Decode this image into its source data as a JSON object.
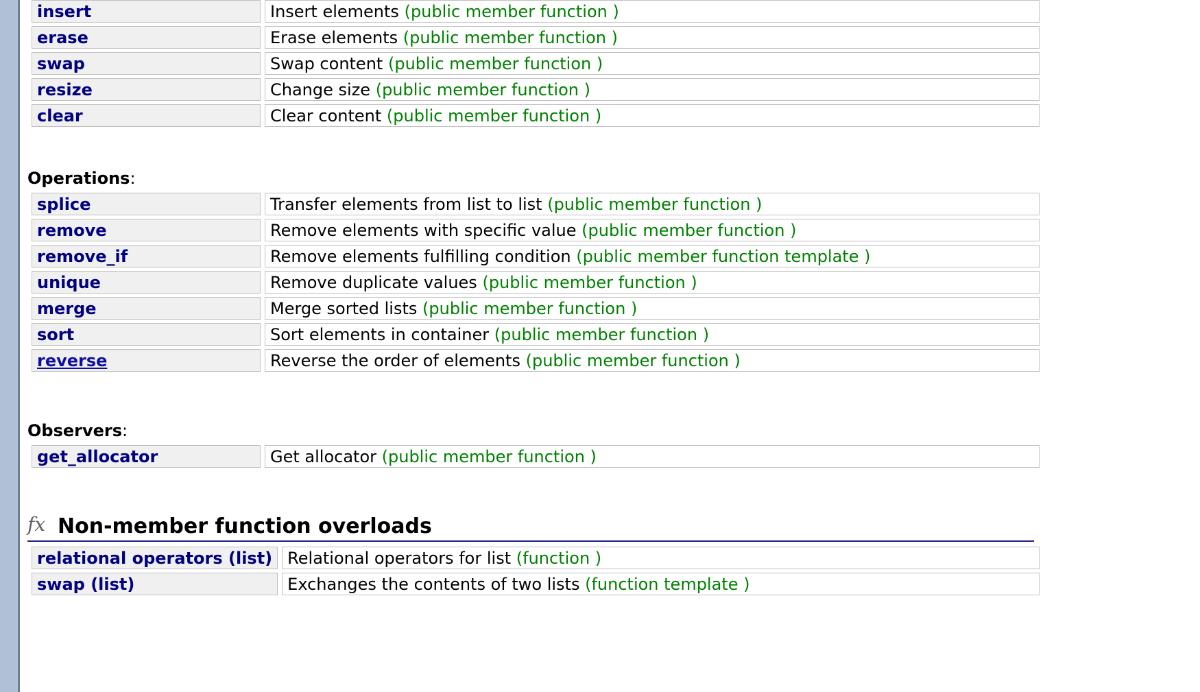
{
  "modifiers": [
    {
      "name": "insert",
      "desc": "Insert elements",
      "kind": "(public member function )"
    },
    {
      "name": "erase",
      "desc": "Erase elements",
      "kind": "(public member function )"
    },
    {
      "name": "swap",
      "desc": "Swap content",
      "kind": "(public member function )"
    },
    {
      "name": "resize",
      "desc": "Change size",
      "kind": "(public member function )"
    },
    {
      "name": "clear",
      "desc": "Clear content",
      "kind": "(public member function )"
    }
  ],
  "operations": {
    "heading": "Operations",
    "items": [
      {
        "name": "splice",
        "desc": "Transfer elements from list to list",
        "kind": "(public member function )"
      },
      {
        "name": "remove",
        "desc": "Remove elements with specific value",
        "kind": "(public member function )"
      },
      {
        "name": "remove_if",
        "desc": "Remove elements fulfilling condition",
        "kind": "(public member function template )"
      },
      {
        "name": "unique",
        "desc": "Remove duplicate values",
        "kind": "(public member function )"
      },
      {
        "name": "merge",
        "desc": "Merge sorted lists",
        "kind": "(public member function )"
      },
      {
        "name": "sort",
        "desc": "Sort elements in container",
        "kind": "(public member function )"
      },
      {
        "name": "reverse",
        "desc": "Reverse the order of elements",
        "kind": "(public member function )"
      }
    ]
  },
  "observers": {
    "heading": "Observers",
    "items": [
      {
        "name": "get_allocator",
        "desc": "Get allocator",
        "kind": "(public member function )"
      }
    ]
  },
  "nonmember": {
    "icon": "fx",
    "heading": "Non-member function overloads",
    "items": [
      {
        "name": "relational operators (list)",
        "desc": "Relational operators for list",
        "kind": "(function )"
      },
      {
        "name": "swap (list)",
        "desc": "Exchanges the contents of two lists",
        "kind": "(function template )"
      }
    ]
  }
}
